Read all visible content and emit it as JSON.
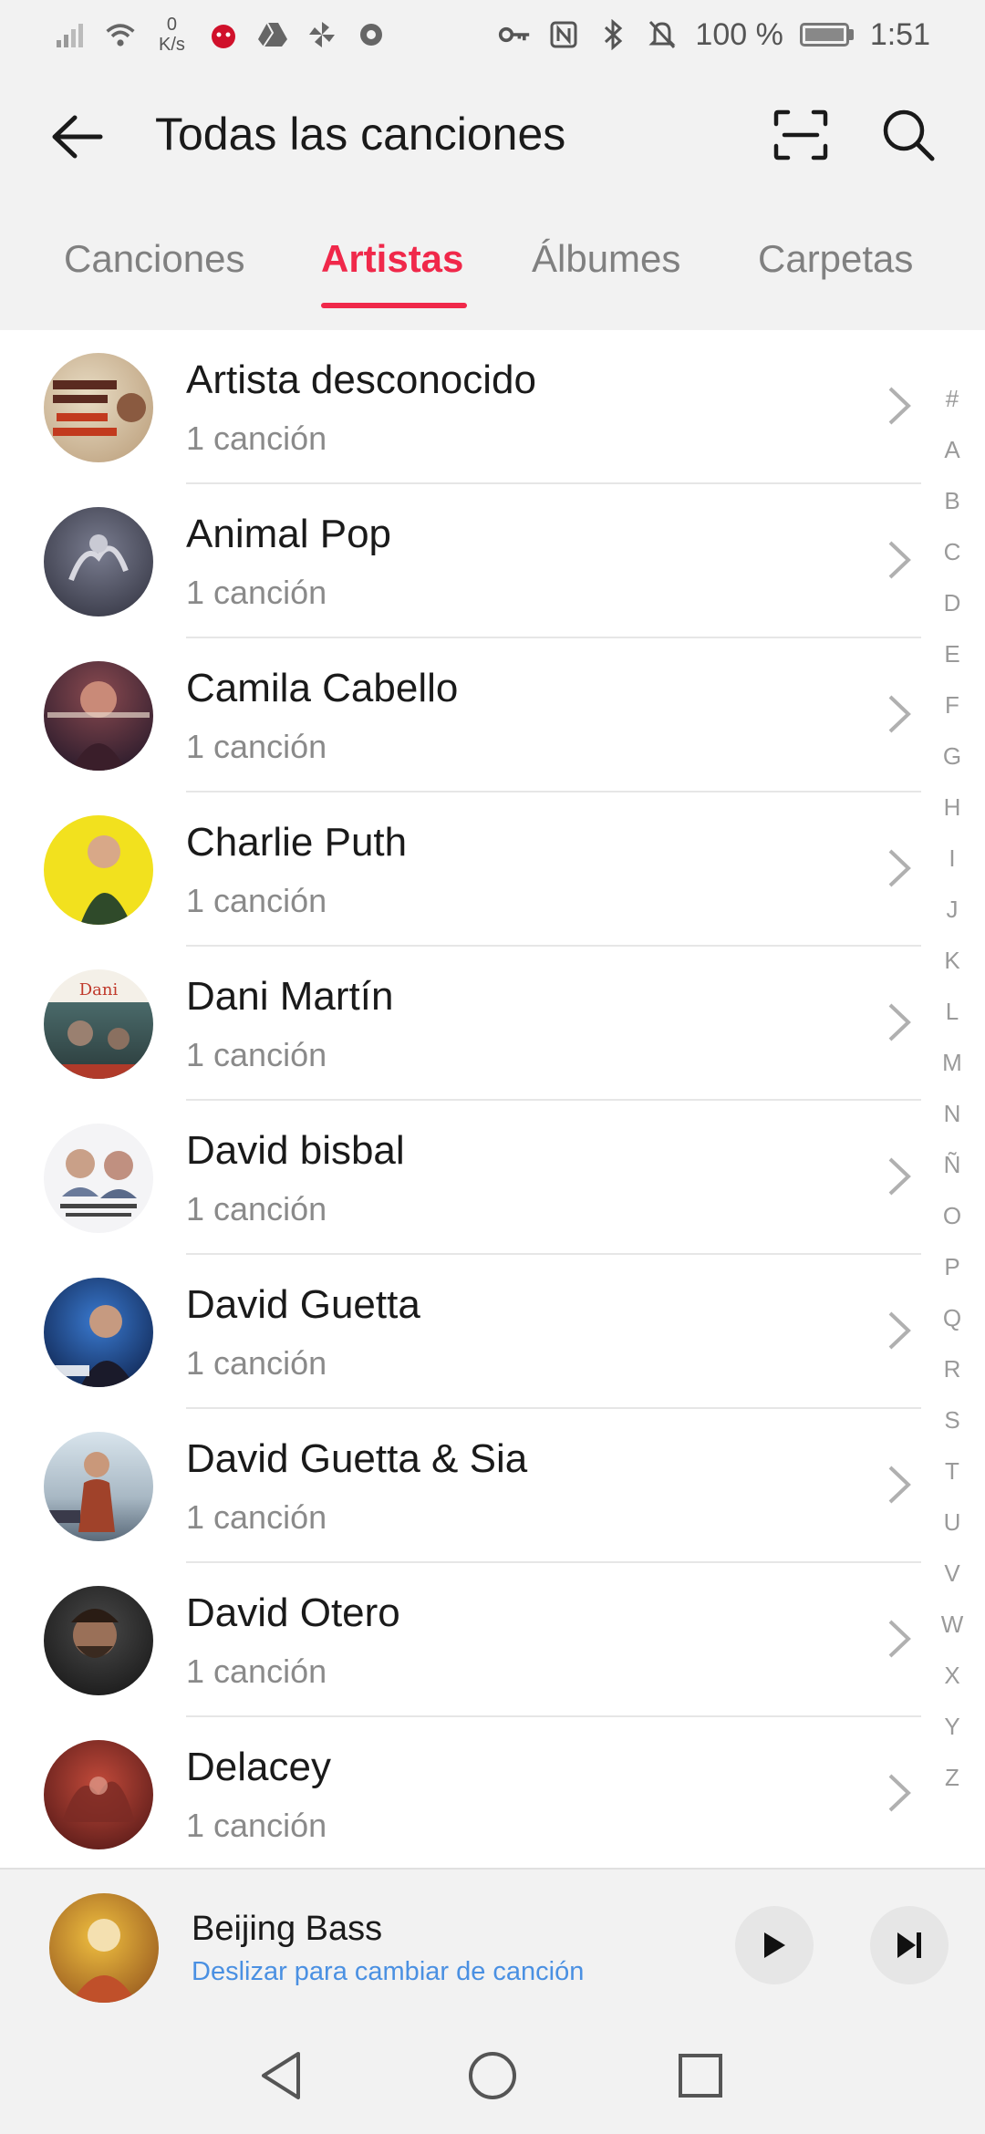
{
  "status_bar": {
    "net_speed_value": "0",
    "net_speed_unit": "K/s",
    "battery": "100 %",
    "time": "1:51"
  },
  "header": {
    "title": "Todas las canciones"
  },
  "tabs": [
    {
      "label": "Canciones",
      "active": false
    },
    {
      "label": "Artistas",
      "active": true
    },
    {
      "label": "Álbumes",
      "active": false
    },
    {
      "label": "Carpetas",
      "active": false
    }
  ],
  "artists": [
    {
      "name": "Artista desconocido",
      "count": "1 canción"
    },
    {
      "name": "Animal Pop",
      "count": "1 canción"
    },
    {
      "name": "Camila Cabello",
      "count": "1 canción"
    },
    {
      "name": "Charlie Puth",
      "count": "1 canción"
    },
    {
      "name": "Dani Martín",
      "count": "1 canción"
    },
    {
      "name": "David bisbal",
      "count": "1 canción"
    },
    {
      "name": "David Guetta",
      "count": "1 canción"
    },
    {
      "name": "David Guetta & Sia",
      "count": "1 canción"
    },
    {
      "name": "David Otero",
      "count": "1 canción"
    },
    {
      "name": "Delacey",
      "count": "1 canción"
    }
  ],
  "index_letters": [
    "#",
    "A",
    "B",
    "C",
    "D",
    "E",
    "F",
    "G",
    "H",
    "I",
    "J",
    "K",
    "L",
    "M",
    "N",
    "Ñ",
    "O",
    "P",
    "Q",
    "R",
    "S",
    "T",
    "U",
    "V",
    "W",
    "X",
    "Y",
    "Z"
  ],
  "player": {
    "title": "Beijing Bass",
    "hint": "Deslizar para cambiar de canción"
  },
  "colors": {
    "accent": "#f0284a",
    "hint": "#4a90e2"
  }
}
